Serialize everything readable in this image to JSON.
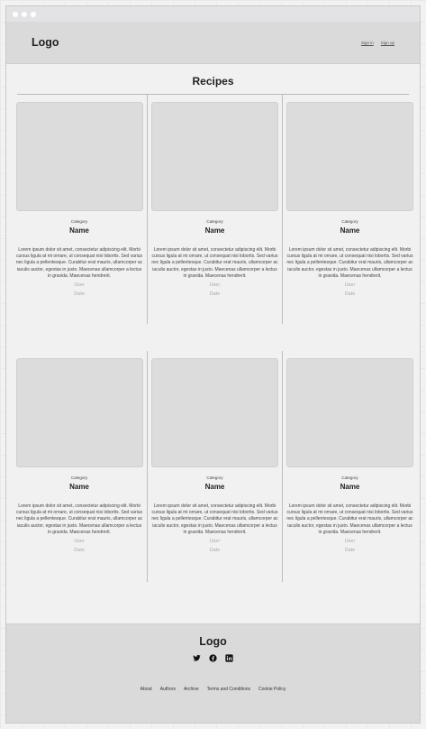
{
  "header": {
    "logo": "Logo",
    "sign_in": "Sign in",
    "sign_up": "Sign up"
  },
  "main": {
    "title": "Recipes"
  },
  "cards": [
    {
      "category": "Category",
      "name": "Name",
      "description": "Lorem ipsum dolor sit amet, consectetur adipiscing elit. Morbi cursus ligula at mi ornare, ut consequat nisi lobortis. Sed varius nec ligula a pellentesque. Curabitur erat mauris, ullamcorper ac iaculis auctor, egestas in justo. Maecenas ullamcorper a lectus in gravida. Maecenas hendrerit.",
      "user": "User",
      "date": "Date"
    },
    {
      "category": "Category",
      "name": "Name",
      "description": "Lorem ipsum dolor sit amet, consectetur adipiscing elit. Morbi cursus ligula at mi ornare, ut consequat nisi lobortis. Sed varius nec ligula a pellentesque. Curabitur erat mauris, ullamcorper ac iaculis auctor, egestas in justo. Maecenas ullamcorper a lectus in gravida. Maecenas hendrerit.",
      "user": "User",
      "date": "Date"
    },
    {
      "category": "Category",
      "name": "Name",
      "description": "Lorem ipsum dolor sit amet, consectetur adipiscing elit. Morbi cursus ligula at mi ornare, ut consequat nisi lobortis. Sed varius nec ligula a pellentesque. Curabitur erat mauris, ullamcorper ac iaculis auctor, egestas in justo. Maecenas ullamcorper a lectus in gravida. Maecenas hendrerit.",
      "user": "User",
      "date": "Date"
    },
    {
      "category": "Category",
      "name": "Name",
      "description": "Lorem ipsum dolor sit amet, consectetur adipiscing elit. Morbi cursus ligula at mi ornare, ut consequat nisi lobortis. Sed varius nec ligula a pellentesque. Curabitur erat mauris, ullamcorper ac iaculis auctor, egestas in justo. Maecenas ullamcorper a lectus in gravida. Maecenas hendrerit.",
      "user": "User",
      "date": "Date"
    },
    {
      "category": "Category",
      "name": "Name",
      "description": "Lorem ipsum dolor sit amet, consectetur adipiscing elit. Morbi cursus ligula at mi ornare, ut consequat nisi lobortis. Sed varius nec ligula a pellentesque. Curabitur erat mauris, ullamcorper ac iaculis auctor, egestas in justo. Maecenas ullamcorper a lectus in gravida. Maecenas hendrerit.",
      "user": "User",
      "date": "Date"
    },
    {
      "category": "Category",
      "name": "Name",
      "description": "Lorem ipsum dolor sit amet, consectetur adipiscing elit. Morbi cursus ligula at mi ornare, ut consequat nisi lobortis. Sed varius nec ligula a pellentesque. Curabitur erat mauris, ullamcorper ac iaculis auctor, egestas in justo. Maecenas ullamcorper a lectus in gravida. Maecenas hendrerit.",
      "user": "User",
      "date": "Date"
    }
  ],
  "footer": {
    "logo": "Logo",
    "social": [
      "twitter-icon",
      "facebook-icon",
      "linkedin-icon"
    ],
    "links": [
      "About",
      "Authors",
      "Archive",
      "Terms and Conditions",
      "Cookie Policy"
    ]
  }
}
